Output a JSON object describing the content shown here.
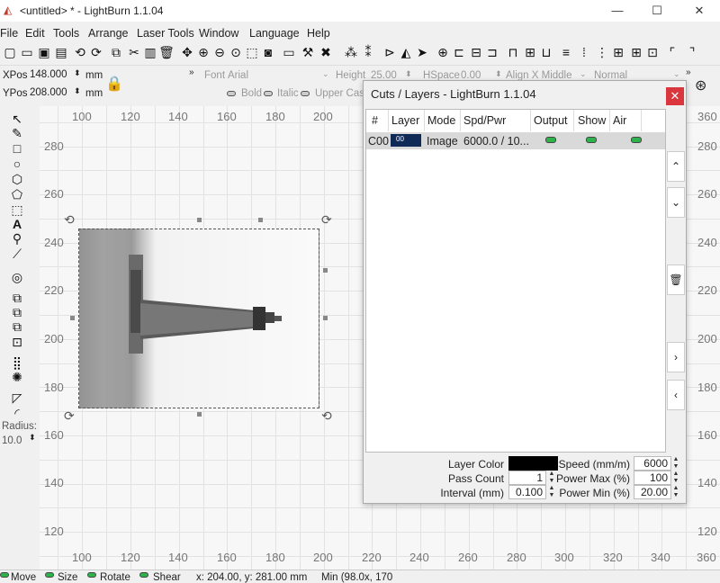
{
  "window": {
    "title": "<untitled> * - LightBurn 1.1.04",
    "minimize": "—",
    "maximize": "☐",
    "close": "✕"
  },
  "menu": [
    "File",
    "Edit",
    "Tools",
    "Arrange",
    "Laser Tools",
    "Window",
    "Language",
    "Help"
  ],
  "props": {
    "xpos_label": "XPos",
    "xpos_value": "148.000",
    "ypos_label": "YPos",
    "ypos_value": "208.000",
    "unit": "mm",
    "font_label": "Font",
    "font_value": "Arial",
    "height_label": "Height",
    "height_value": "25.00",
    "hspace_label": "HSpace",
    "hspace_value": "0.00",
    "align_x": "Align X Middle",
    "normal": "Normal",
    "bold": "Bold",
    "italic": "Italic",
    "upper_case": "Upper Case"
  },
  "left_tools": {
    "radius_label": "Radius:",
    "radius_value": "10.0"
  },
  "rulers": {
    "top": [
      "100",
      "120",
      "140",
      "160",
      "180",
      "200",
      "360"
    ],
    "bottom": [
      "100",
      "120",
      "140",
      "160",
      "180",
      "200",
      "220",
      "240",
      "260",
      "280",
      "300",
      "320",
      "340",
      "360"
    ],
    "left": [
      "280",
      "260",
      "240",
      "220",
      "200",
      "180",
      "160",
      "140",
      "120"
    ],
    "right": [
      "280",
      "260",
      "240",
      "220",
      "200",
      "180",
      "160",
      "140",
      "120"
    ]
  },
  "cuts_dialog": {
    "title": "Cuts / Layers - LightBurn 1.1.04",
    "columns": [
      "#",
      "Layer",
      "Mode",
      "Spd/Pwr",
      "Output",
      "Show",
      "Air"
    ],
    "rows": [
      {
        "num": "C00",
        "layer": "00",
        "mode": "Image",
        "spdpwr": "6000.0 / 10...",
        "output": true,
        "show": true,
        "air": true
      }
    ],
    "layer_color_label": "Layer Color",
    "layer_color": "#000000",
    "speed_label": "Speed (mm/m)",
    "speed_value": "6000",
    "pass_count_label": "Pass Count",
    "pass_count_value": "1",
    "power_max_label": "Power Max (%)",
    "power_max_value": "100",
    "interval_label": "Interval (mm)",
    "interval_value": "0.100",
    "power_min_label": "Power Min (%)",
    "power_min_value": "20.00"
  },
  "status": {
    "move": "Move",
    "size": "Size",
    "rotate": "Rotate",
    "shear": "Shear",
    "coords": "x: 204.00, y: 281.00 mm",
    "min": "Min (98.0x, 170"
  },
  "colors": {
    "accent_green": "#2db34a",
    "close_red": "#d9363e",
    "layer_chip": "#102a57"
  }
}
